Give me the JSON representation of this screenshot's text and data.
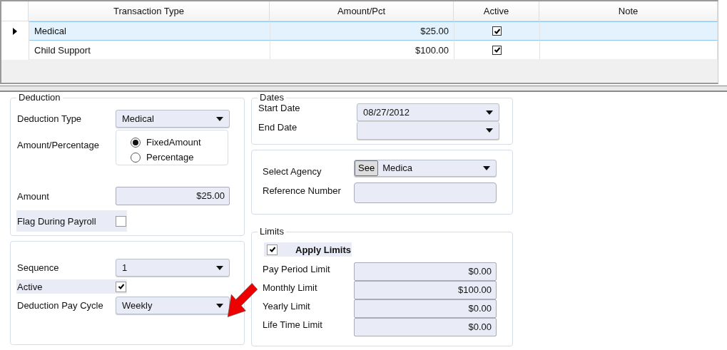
{
  "grid": {
    "columns": [
      "Transaction Type",
      "Amount/Pct",
      "Active",
      "Note"
    ],
    "rows": [
      {
        "type": "Medical",
        "amount": "$25.00",
        "active": true,
        "selected": true
      },
      {
        "type": "Child Support",
        "amount": "$100.00",
        "active": true,
        "selected": false
      }
    ]
  },
  "deduction": {
    "title": "Deduction",
    "type_label": "Deduction Type",
    "type_value": "Medical",
    "amount_pct_label": "Amount/Percentage",
    "options": [
      {
        "label": "FixedAmount",
        "selected": true
      },
      {
        "label": "Percentage",
        "selected": false
      }
    ],
    "amount_label": "Amount",
    "amount_value": "$25.00",
    "flag_label": "Flag During Payroll",
    "flag_checked": false
  },
  "schedule": {
    "sequence_label": "Sequence",
    "sequence_value": "1",
    "active_label": "Active",
    "active_checked": true,
    "cycle_label": "Deduction Pay Cycle",
    "cycle_value": "Weekly"
  },
  "dates": {
    "title": "Dates",
    "start_label": "Start Date",
    "start_value": "08/27/2012",
    "end_label": "End Date"
  },
  "agency": {
    "select_label": "Select Agency",
    "see_button": "See",
    "agency_value": "Medica",
    "reference_label": "Reference Number"
  },
  "limits": {
    "title": "Limits",
    "apply_label": "Apply Limits",
    "apply_checked": true,
    "items": [
      {
        "label": "Pay Period Limit",
        "value": "$0.00"
      },
      {
        "label": "Monthly Limit",
        "value": "$100.00"
      },
      {
        "label": "Yearly Limit",
        "value": "$0.00"
      },
      {
        "label": "Life Time Limit",
        "value": "$0.00"
      }
    ]
  }
}
